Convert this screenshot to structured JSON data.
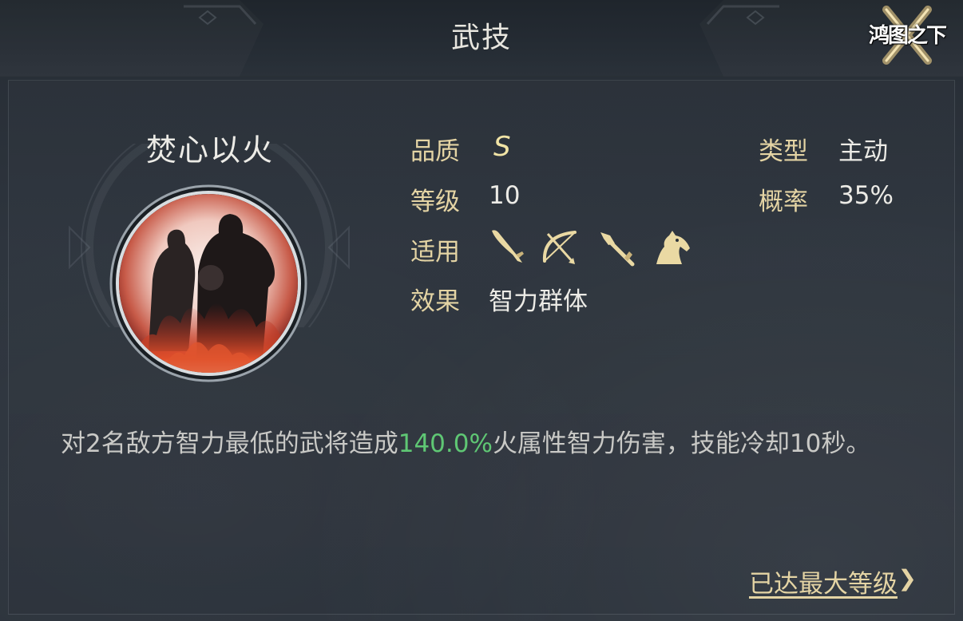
{
  "header": {
    "title": "武技",
    "logo_text": "鸿图之下"
  },
  "skill": {
    "name": "焚心以火",
    "portrait_icon": "fire-warriors-icon"
  },
  "attributes": {
    "quality_label": "品质",
    "quality_value": "S",
    "level_label": "等级",
    "level_value": "10",
    "applicable_label": "适用",
    "applicable_icons": [
      "saber-icon",
      "bow-icon",
      "spear-icon",
      "horse-icon"
    ],
    "effect_label": "效果",
    "effect_value": "智力群体",
    "type_label": "类型",
    "type_value": "主动",
    "chance_label": "概率",
    "chance_value": "35%"
  },
  "description": {
    "prefix": "对2名敌方智力最低的武将造成",
    "highlight": "140.0%",
    "suffix": "火属性智力伤害，技能冷却10秒。"
  },
  "footer": {
    "max_level_label": "已达最大等级"
  },
  "colors": {
    "label_gold": "#e4d4a4",
    "highlight_green": "#5fc774",
    "text_white": "#ecebe6"
  }
}
